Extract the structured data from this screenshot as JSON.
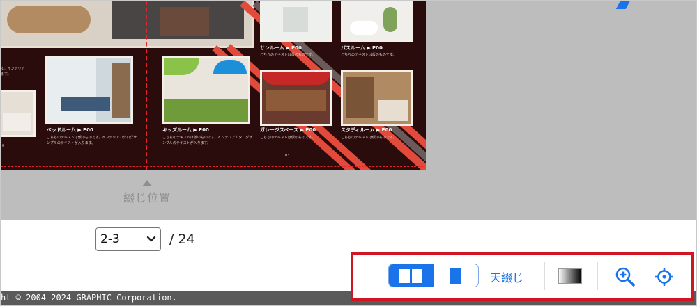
{
  "preview": {
    "spread": {
      "left_captions": [
        {
          "title": "ベッドルーム ▶ P00",
          "text": "こちらのテキストは仮のものです。インテリアカタログサンプルのテキストが入ります。"
        }
      ],
      "right_captions": [
        {
          "title": "キッズルーム ▶ P00",
          "text": "こちらのテキストは仮のものです。インテリアカタログサンプルのテキストが入ります。"
        },
        {
          "title": "ガレージスペース ▶ P00",
          "text": "こちらのテキストは仮のものです。"
        },
        {
          "title": "スタディルーム ▶ P00",
          "text": "こちらのテキストは仮のものです。"
        },
        {
          "title": "サンルーム ▶ P00",
          "text": "こちらのテキストは仮のものです。"
        },
        {
          "title": "バスルーム ▶ P00",
          "text": "こちらのテキストは仮のものです。"
        }
      ],
      "left_edge_text": {
        "line1": "す。インテリア",
        "line2": "ます。"
      },
      "left_page_no_fragment": "0",
      "right_page_no": "03"
    },
    "binding_marker": {
      "label": "綴じ位置"
    }
  },
  "pager": {
    "selected": "2-3",
    "total": "/ 24"
  },
  "toolbar": {
    "view_modes": [
      "spread-view",
      "single-view"
    ],
    "active_view": "spread-view",
    "bind_mode_label": "天綴じ"
  },
  "footer": {
    "copyright": "ht © 2004-2024 GRAPHIC Corporation."
  },
  "colors": {
    "accent": "#1a73e8",
    "highlight": "#d01623",
    "spread_bg": "#2b0c0c",
    "stripe_red": "#e24a3b",
    "stripe_gray": "#6b5a5a"
  }
}
